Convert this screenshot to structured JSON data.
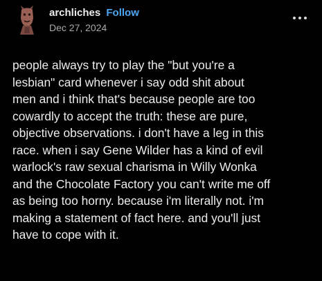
{
  "post": {
    "author": {
      "username": "archliches",
      "avatar_icon": "gargoyle-statue-avatar"
    },
    "follow_label": "Follow",
    "date": "Dec 27, 2024",
    "more_icon": "more-options-icon",
    "body_lines": [
      "people always try to play the \"but you're a",
      "lesbian\" card whenever i say odd shit about",
      "men and i think that's because people are too",
      "cowardly to accept the truth: these are pure,",
      "objective observations. i don't have a leg in this",
      "race. when i say Gene Wilder has a kind of evil",
      "warlock's raw sexual charisma in Willy Wonka",
      "and the Chocolate Factory you can't write me off",
      "as being too horny. because i'm literally not. i'm",
      "making a statement of fact here. and you'll just",
      "have to cope with it."
    ]
  },
  "colors": {
    "background": "#000000",
    "text": "#ececec",
    "follow_accent": "#4ea7f2",
    "muted": "#a9a9a9"
  }
}
